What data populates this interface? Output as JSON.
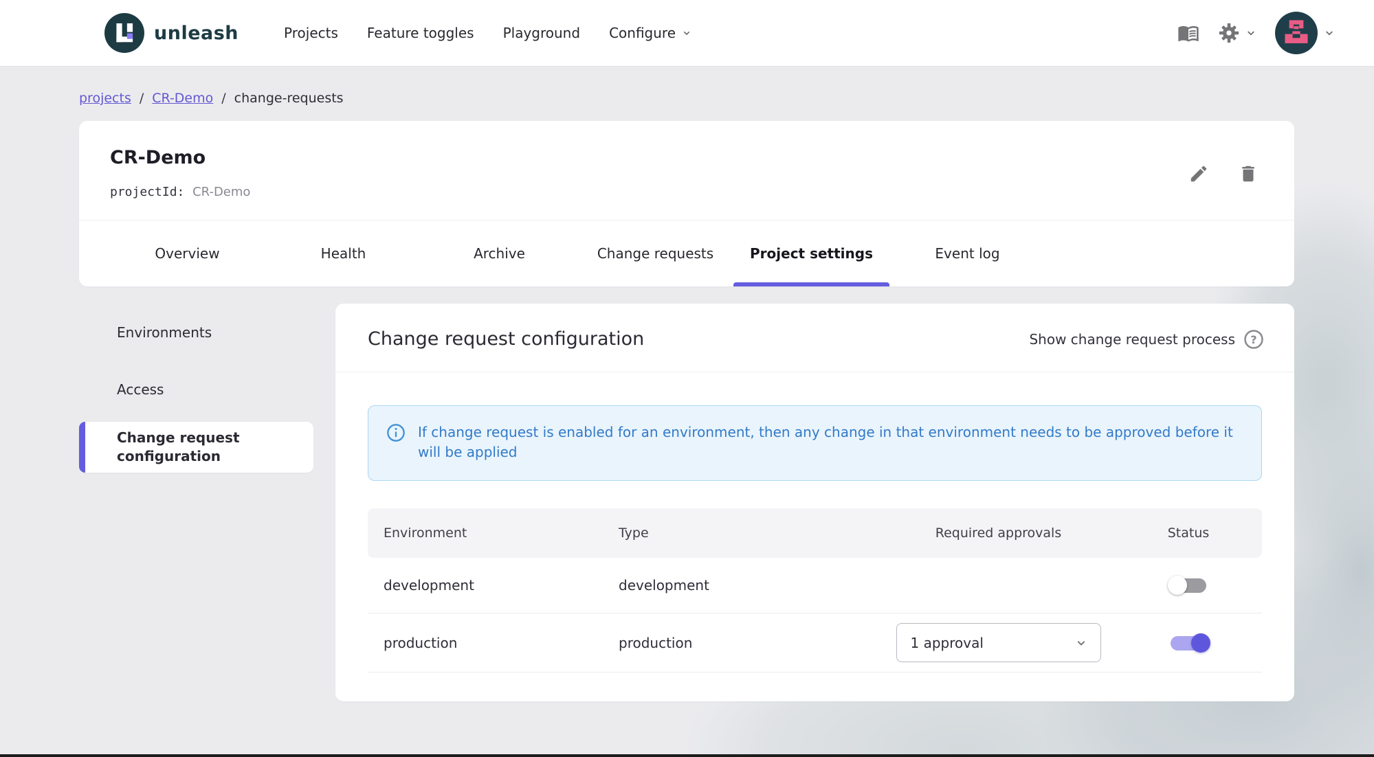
{
  "topnav": {
    "brand": "unleash",
    "links": [
      {
        "label": "Projects"
      },
      {
        "label": "Feature toggles"
      },
      {
        "label": "Playground"
      },
      {
        "label": "Configure"
      }
    ]
  },
  "breadcrumb": {
    "separator": "/",
    "items": [
      {
        "label": "projects",
        "link": true
      },
      {
        "label": "CR-Demo",
        "link": true
      },
      {
        "label": "change-requests",
        "link": false
      }
    ]
  },
  "project_header": {
    "title": "CR-Demo",
    "project_id_label": "projectId:",
    "project_id_value": "CR-Demo"
  },
  "tabs": [
    {
      "label": "Overview",
      "active": false
    },
    {
      "label": "Health",
      "active": false
    },
    {
      "label": "Archive",
      "active": false
    },
    {
      "label": "Change requests",
      "active": false
    },
    {
      "label": "Project settings",
      "active": true
    },
    {
      "label": "Event log",
      "active": false
    }
  ],
  "sidebar": {
    "items": [
      {
        "label": "Environments",
        "active": false
      },
      {
        "label": "Access",
        "active": false
      },
      {
        "label": "Change request configuration",
        "active": true
      }
    ]
  },
  "panel": {
    "title": "Change request configuration",
    "action_label": "Show change request process",
    "alert": {
      "text": "If change request is enabled for an environment, then any change in that environment needs to be approved before it will be applied"
    },
    "table": {
      "headers": [
        "Environment",
        "Type",
        "Required approvals",
        "Status"
      ],
      "rows": [
        {
          "environment": "development",
          "type": "development",
          "required_approvals": "",
          "status_enabled": false
        },
        {
          "environment": "production",
          "type": "production",
          "required_approvals": "1 approval",
          "status_enabled": true
        }
      ]
    }
  },
  "icons": {
    "book": "docs-icon",
    "gear": "settings-icon",
    "avatar": "user-avatar",
    "edit": "edit-icon",
    "delete": "delete-icon",
    "help": "help-icon",
    "info": "info-icon"
  },
  "colors": {
    "accent_purple": "#635de0",
    "toggle_track_on": "#aba6ef",
    "brand_teal": "#1d3b43",
    "avatar_pink": "#e95c85",
    "alert_blue_text": "#327ac8",
    "alert_blue_bg": "#e9f4fc",
    "alert_blue_border": "#abd7f2",
    "page_bg": "#ebebee",
    "icon_gray": "#757578"
  }
}
